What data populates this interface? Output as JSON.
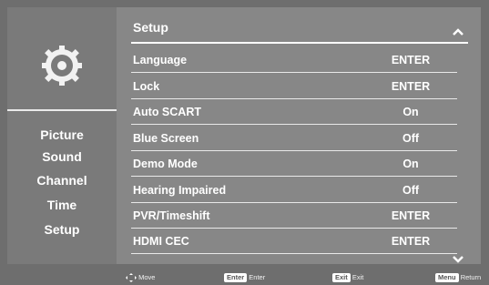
{
  "nav": {
    "items": [
      "Picture",
      "Sound",
      "Channel",
      "Time",
      "Setup"
    ]
  },
  "menu": {
    "title": "Setup",
    "rows": [
      {
        "label": "Language",
        "value": "ENTER"
      },
      {
        "label": "Lock",
        "value": "ENTER"
      },
      {
        "label": "Auto SCART",
        "value": "On"
      },
      {
        "label": "Blue Screen",
        "value": "Off"
      },
      {
        "label": "Demo Mode",
        "value": "On"
      },
      {
        "label": "Hearing Impaired",
        "value": "Off"
      },
      {
        "label": "PVR/Timeshift",
        "value": "ENTER"
      },
      {
        "label": "HDMI CEC",
        "value": "ENTER"
      }
    ]
  },
  "footer": {
    "move": "Move",
    "enter_key": "Enter",
    "enter_label": "Enter",
    "exit_key": "Exit",
    "exit_label": "Exit",
    "menu_key": "Menu",
    "menu_label": "Return"
  },
  "icons": {
    "main": "gear-icon",
    "scroll_up": "chevron-up-icon",
    "scroll_down": "chevron-down-icon",
    "move": "dpad-arrows-icon"
  },
  "colors": {
    "background": "#6e6e6e",
    "left_panel": "#7a7a7a",
    "right_panel": "#878787",
    "text": "#ffffff"
  }
}
